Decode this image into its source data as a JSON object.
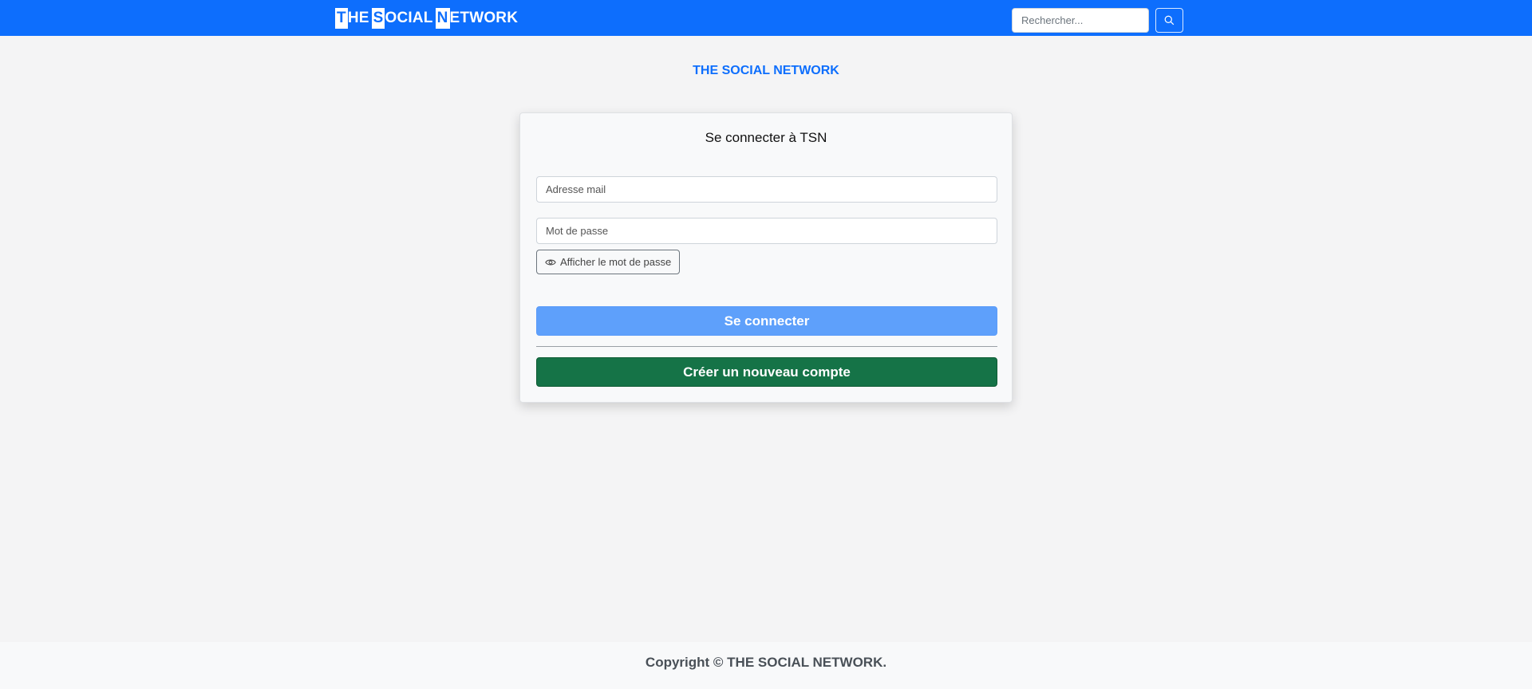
{
  "navbar": {
    "brand": [
      {
        "hl": "T",
        "rest": "HE"
      },
      {
        "hl": "S",
        "rest": "OCIAL"
      },
      {
        "hl": "N",
        "rest": "ETWORK"
      }
    ],
    "search_placeholder": "Rechercher...",
    "search_icon": "search-icon",
    "bg_color": "#0d6efd"
  },
  "main": {
    "site_title": "THE SOCIAL NETWORK"
  },
  "login_card": {
    "title": "Se connecter à TSN",
    "email_placeholder": "Adresse mail",
    "password_placeholder": "Mot de passe",
    "show_password_label": "Afficher le mot de passe",
    "show_password_icon": "eye-icon",
    "login_button": "Se connecter",
    "create_account_button": "Créer un nouveau compte",
    "colors": {
      "login": "#5ea0fb",
      "create": "#157347"
    }
  },
  "footer": {
    "copyright": "Copyright © THE SOCIAL NETWORK."
  }
}
